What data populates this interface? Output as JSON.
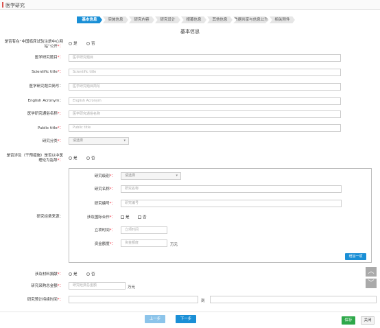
{
  "app": {
    "title": "医学研究"
  },
  "steps": [
    "基本信息",
    "实施信息",
    "研究内容",
    "研究设计",
    "报募信息",
    "其他信息",
    "数据共享与信息公开",
    "相关附件"
  ],
  "section_title": "基本信息",
  "yes": "是",
  "no": "否",
  "fields": {
    "registered": {
      "label": "是否有在“中国临床试验注册中心网站”公开",
      "req": "*："
    },
    "cn_title": {
      "label": "医学研究题目",
      "req": "*：",
      "placeholder": "医学研究题目"
    },
    "sci_title": {
      "label": "Scientific title",
      "req": "*：",
      "placeholder": "Scientific title"
    },
    "cn_short": {
      "label": "医学研究题目简写：",
      "placeholder": "医学研究题目简写"
    },
    "acronym": {
      "label": "English Acronym：",
      "placeholder": "English Acronym"
    },
    "popular_name": {
      "label": "医学研究通俗名称",
      "req": "*：",
      "placeholder": "医学研究通俗名称"
    },
    "public_title": {
      "label": "Public title",
      "req": "*：",
      "placeholder": "Public title"
    },
    "category": {
      "label": "研究分类",
      "req": "*：",
      "value": "请选择"
    },
    "intervention": {
      "label": "是否涉及（干预措施）是否以中医理论为指导",
      "req": "*："
    },
    "funding": {
      "label": "研究经费来源："
    },
    "materials": {
      "label": "涉及材料捐献",
      "req": "*："
    },
    "total_funding": {
      "label": "研究采购总金额",
      "req": "*：",
      "placeholder": "研究经费总金额",
      "unit": "万元"
    },
    "duration": {
      "label": "研究预计持续时间",
      "req": "*：",
      "to": "到"
    }
  },
  "fund": {
    "level": {
      "label": "研究级别",
      "req": "*：",
      "value": "请选择"
    },
    "name": {
      "label": "研究名称",
      "req": "*：",
      "placeholder": "研究名称"
    },
    "number": {
      "label": "研究编号",
      "req": "*：",
      "placeholder": "研究编号"
    },
    "intl": {
      "label": "涉及国际合作",
      "req": "*："
    },
    "date": {
      "label": "立项时间",
      "req": "*：",
      "placeholder": "立项时间"
    },
    "amount": {
      "label": "资金额度",
      "req": "*：",
      "placeholder": "资金额度",
      "unit": "万元"
    },
    "add": "增加一项"
  },
  "buttons": {
    "prev": "上一步",
    "next": "下一步",
    "save": "保存",
    "close": "关闭"
  }
}
